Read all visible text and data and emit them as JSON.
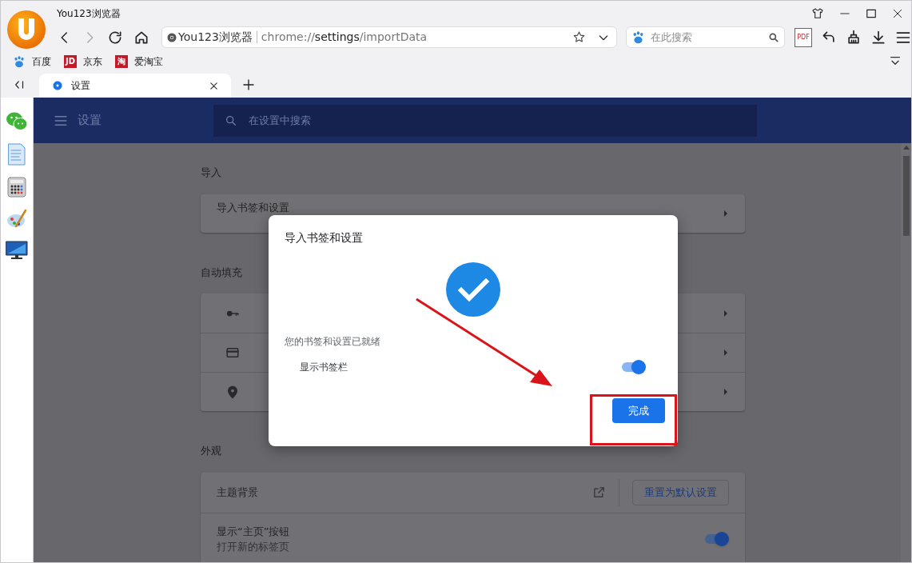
{
  "window": {
    "title": "You123浏览器"
  },
  "nav": {
    "back_disabled": false,
    "forward_disabled": true
  },
  "address_bar": {
    "site_name": "You123浏览器",
    "url_scheme": "chrome://",
    "url_host": "settings",
    "url_path": "/importData"
  },
  "search": {
    "placeholder": "在此搜索"
  },
  "toolbar": {
    "pdf_label": "PDF"
  },
  "bookmarks": [
    {
      "label": "百度",
      "kind": "paw"
    },
    {
      "label": "京东",
      "kind": "badge",
      "badge": "JD"
    },
    {
      "label": "爱淘宝",
      "kind": "badge",
      "badge": "淘"
    }
  ],
  "tabs": [
    {
      "label": "设置",
      "selected": true
    }
  ],
  "settings": {
    "title": "设置",
    "search_placeholder": "在设置中搜索",
    "sections": [
      {
        "title": "导入",
        "rows": [
          {
            "kind": "link",
            "label": "导入书签和设置"
          }
        ]
      },
      {
        "title": "自动填充",
        "rows": [
          {
            "kind": "icon_link"
          },
          {
            "kind": "icon_link"
          },
          {
            "kind": "icon_link"
          }
        ]
      },
      {
        "title": "外观",
        "rows": [
          {
            "kind": "theme",
            "label": "主题背景",
            "button": "重置为默认设置"
          },
          {
            "kind": "toggle",
            "label": "显示“主页”按钮",
            "sublabel": "打开新的标签页",
            "on": true
          }
        ]
      }
    ]
  },
  "dialog": {
    "title": "导入书签和设置",
    "message": "您的书签和设置已就绪",
    "toggle": {
      "label": "显示书签栏",
      "on": true
    },
    "button": "完成"
  }
}
